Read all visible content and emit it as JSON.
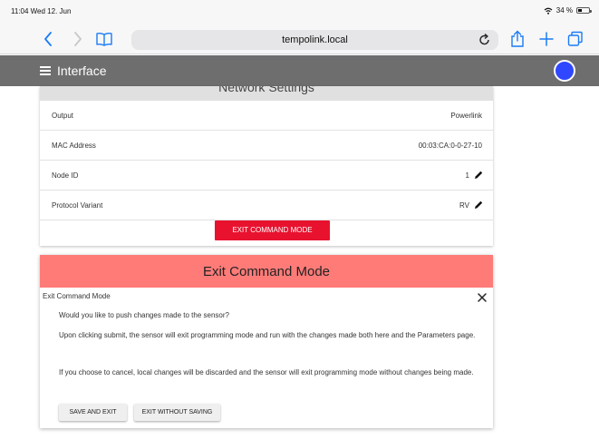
{
  "status_bar": {
    "time_date": "11:04  Wed 12. Jun",
    "battery": "34 %"
  },
  "browser": {
    "url": "tempolink.local"
  },
  "app": {
    "title": "Interface",
    "status_color": "#2f47ff"
  },
  "network_settings": {
    "title": "Network Settings",
    "rows": [
      {
        "label": "Output",
        "value": "Powerlink",
        "editable": false
      },
      {
        "label": "MAC Address",
        "value": "00:03:CA:0-0-27-10",
        "editable": false
      },
      {
        "label": "Node ID",
        "value": "1",
        "editable": true
      },
      {
        "label": "Protocol Variant",
        "value": "RV",
        "editable": true
      }
    ],
    "exit_button": "EXIT COMMAND MODE"
  },
  "dialog": {
    "header": "Exit Command Mode",
    "subtitle": "Exit Command Mode",
    "question": "Would you like to push changes made to the sensor?",
    "submit_info": "Upon clicking submit, the sensor will exit programming mode and run with the changes made both here and the Parameters page.",
    "cancel_info": "If you choose to cancel, local changes will be discarded and the sensor will exit programming mode without changes being made.",
    "save_button": "SAVE AND EXIT",
    "discard_button": "EXIT WITHOUT SAVING"
  },
  "colors": {
    "accent_red": "#e8122f",
    "dialog_header": "#ff7b78",
    "app_header": "#6e6e6e"
  }
}
